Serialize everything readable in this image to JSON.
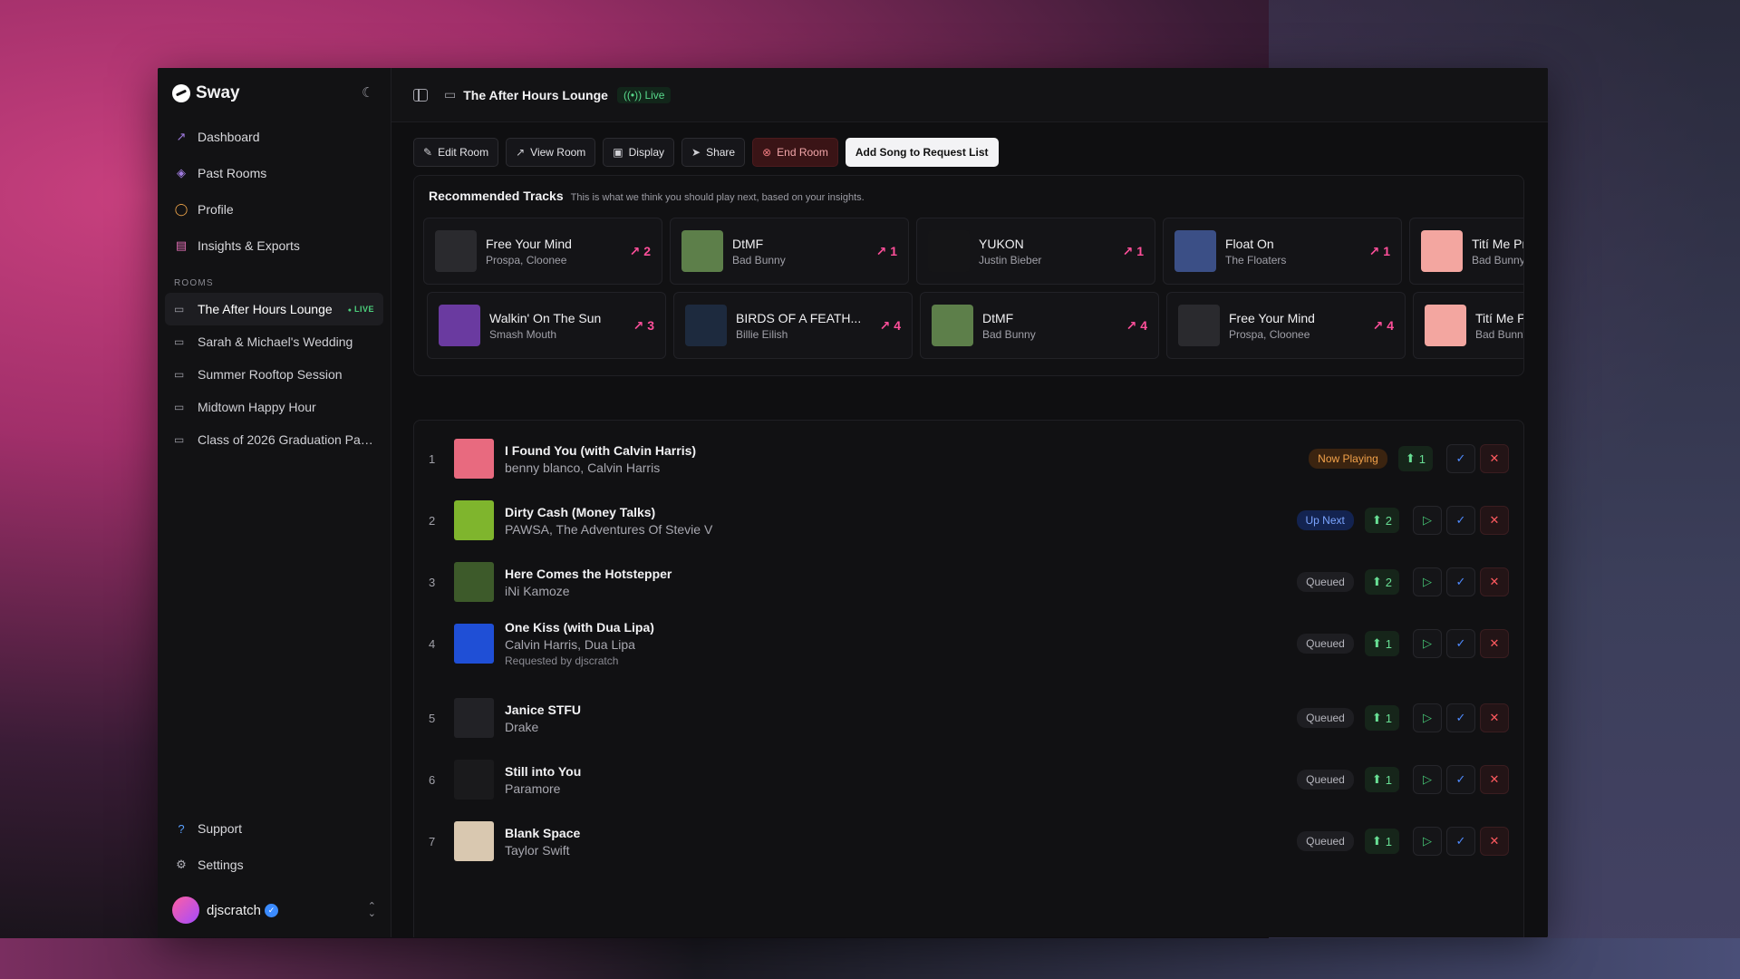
{
  "app": {
    "name": "Sway"
  },
  "sidebar": {
    "nav": [
      {
        "label": "Dashboard",
        "icon": "chart-line-icon"
      },
      {
        "label": "Past Rooms",
        "icon": "layers-icon"
      },
      {
        "label": "Profile",
        "icon": "user-icon"
      },
      {
        "label": "Insights & Exports",
        "icon": "file-chart-icon"
      }
    ],
    "rooms_label": "ROOMS",
    "rooms": [
      {
        "label": "The After Hours Lounge",
        "live": "LIVE"
      },
      {
        "label": "Sarah & Michael's Wedding"
      },
      {
        "label": "Summer Rooftop Session"
      },
      {
        "label": "Midtown Happy Hour"
      },
      {
        "label": "Class of 2026 Graduation Par..."
      }
    ],
    "support": "Support",
    "settings": "Settings",
    "user": {
      "name": "djscratch"
    }
  },
  "header": {
    "room_title": "The After Hours Lounge",
    "live": "Live"
  },
  "toolbar": {
    "edit": "Edit Room",
    "view": "View Room",
    "display": "Display",
    "share": "Share",
    "end": "End Room",
    "add": "Add Song to Request List"
  },
  "recommended": {
    "title": "Recommended Tracks",
    "subtitle": "This is what we think you should play next, based on your insights.",
    "rows": [
      [
        {
          "title": "Free Your Mind",
          "artist": "Prospa, Cloonee",
          "trend": "2",
          "art": "#2a2a2e"
        },
        {
          "title": "DtMF",
          "artist": "Bad Bunny",
          "trend": "1",
          "art": "#5d7f4a"
        },
        {
          "title": "YUKON",
          "artist": "Justin Bieber",
          "trend": "1",
          "art": "#151517"
        },
        {
          "title": "Float On",
          "artist": "The Floaters",
          "trend": "1",
          "art": "#3b4f86"
        },
        {
          "title": "Tití Me Preguntó",
          "artist": "Bad Bunny",
          "trend": "",
          "art": "#f3a6a0"
        }
      ],
      [
        {
          "title": "Walkin' On The Sun",
          "artist": "Smash Mouth",
          "trend": "3",
          "art": "#6a3aa0"
        },
        {
          "title": "BIRDS OF A FEATH...",
          "artist": "Billie Eilish",
          "trend": "4",
          "art": "#1d2a3e"
        },
        {
          "title": "DtMF",
          "artist": "Bad Bunny",
          "trend": "4",
          "art": "#5d7f4a"
        },
        {
          "title": "Free Your Mind",
          "artist": "Prospa, Cloonee",
          "trend": "4",
          "art": "#2a2a2e"
        },
        {
          "title": "Tití Me Preguntó",
          "artist": "Bad Bunny",
          "trend": "",
          "art": "#f3a6a0"
        }
      ]
    ]
  },
  "queue": [
    {
      "num": "1",
      "title": "I Found You (with Calvin Harris)",
      "artist": "benny blanco, Calvin Harris",
      "status": "Now Playing",
      "kind": "playing",
      "likes": "1",
      "art": "#e86a7f"
    },
    {
      "num": "2",
      "title": "Dirty Cash (Money Talks)",
      "artist": "PAWSA, The Adventures Of Stevie V",
      "status": "Up Next",
      "kind": "next",
      "likes": "2",
      "art": "#7fb52d"
    },
    {
      "num": "3",
      "title": "Here Comes the Hotstepper",
      "artist": "iNi Kamoze",
      "status": "Queued",
      "kind": "queued",
      "likes": "2",
      "art": "#3d5a2a"
    },
    {
      "num": "4",
      "title": "One Kiss (with Dua Lipa)",
      "artist": "Calvin Harris, Dua Lipa",
      "requested": "Requested by djscratch",
      "status": "Queued",
      "kind": "queued",
      "likes": "1",
      "art": "#1f4fd6"
    },
    {
      "num": "5",
      "title": "Janice STFU",
      "artist": "Drake",
      "status": "Queued",
      "kind": "queued",
      "likes": "1",
      "art": "#222226"
    },
    {
      "num": "6",
      "title": "Still into You",
      "artist": "Paramore",
      "status": "Queued",
      "kind": "queued",
      "likes": "1",
      "art": "#1a1a1c"
    },
    {
      "num": "7",
      "title": "Blank Space",
      "artist": "Taylor Swift",
      "status": "Queued",
      "kind": "queued",
      "likes": "1",
      "art": "#d9c8b0"
    }
  ]
}
